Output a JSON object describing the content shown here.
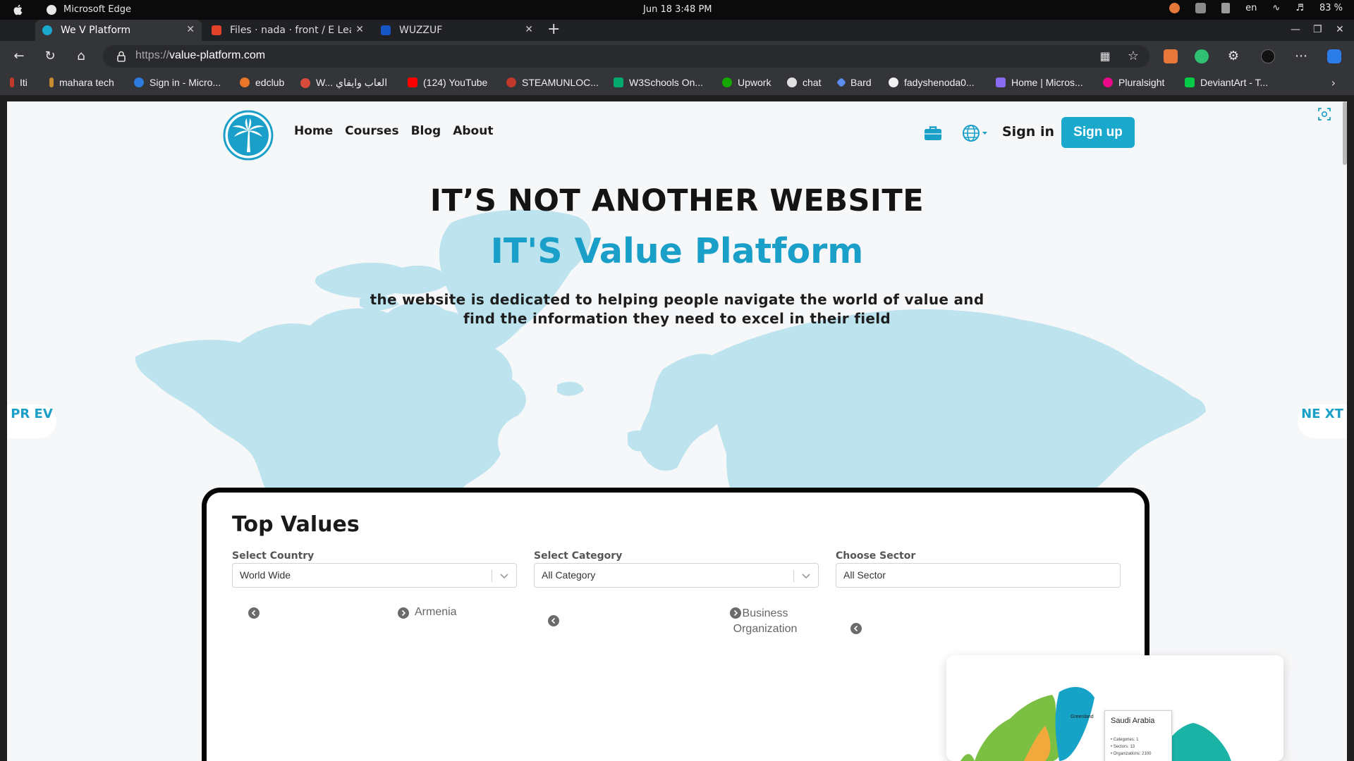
{
  "os": {
    "app_name": "Microsoft Edge",
    "clock": "Jun 18   3:48 PM",
    "lang": "en",
    "battery": "83 %"
  },
  "tabs": [
    {
      "label": "We V Platform",
      "active": true
    },
    {
      "label": "Files · nada · front / E Lear",
      "active": false
    },
    {
      "label": "WUZZUF",
      "active": false
    }
  ],
  "address": {
    "scheme": "https://",
    "host": "value-platform.com"
  },
  "bookmarks": [
    "Iti",
    "mahara tech",
    "Sign in - Micro...",
    "edclub",
    "W... العاب وايفاي",
    "(124) YouTube",
    "STEAMUNLOC...",
    "W3Schools On...",
    "Upwork",
    "chat",
    "Bard",
    "fadyshenoda0...",
    "Home | Micros...",
    "Pluralsight",
    "DeviantArt - T..."
  ],
  "site": {
    "nav": [
      "Home",
      "Courses",
      "Blog",
      "About"
    ],
    "sign_in": "Sign in",
    "sign_up": "Sign up",
    "hero_title": "IT’S NOT ANOTHER WEBSITE",
    "hero_subtitle": "IT'S Value Platform",
    "hero_description": "the website is dedicated to helping people navigate the world of value and find the information they need to excel in their field",
    "prev_label": "PR EV",
    "next_label": "NE XT",
    "accent_color": "#1aa8cc"
  },
  "top_values": {
    "title": "Top Values",
    "country": {
      "label": "Select Country",
      "value": "World Wide",
      "option": "Armenia"
    },
    "category": {
      "label": "Select Category",
      "value": "All Category",
      "option": "Business Organization"
    },
    "sector": {
      "label": "Choose Sector",
      "value": "All Sector"
    }
  },
  "map_tooltip": {
    "title": "Saudi Arabia",
    "lines": [
      "• Categories: 1",
      "• Sectors: 13",
      "• Organizations: 2100"
    ],
    "region_label": "Greenland"
  }
}
